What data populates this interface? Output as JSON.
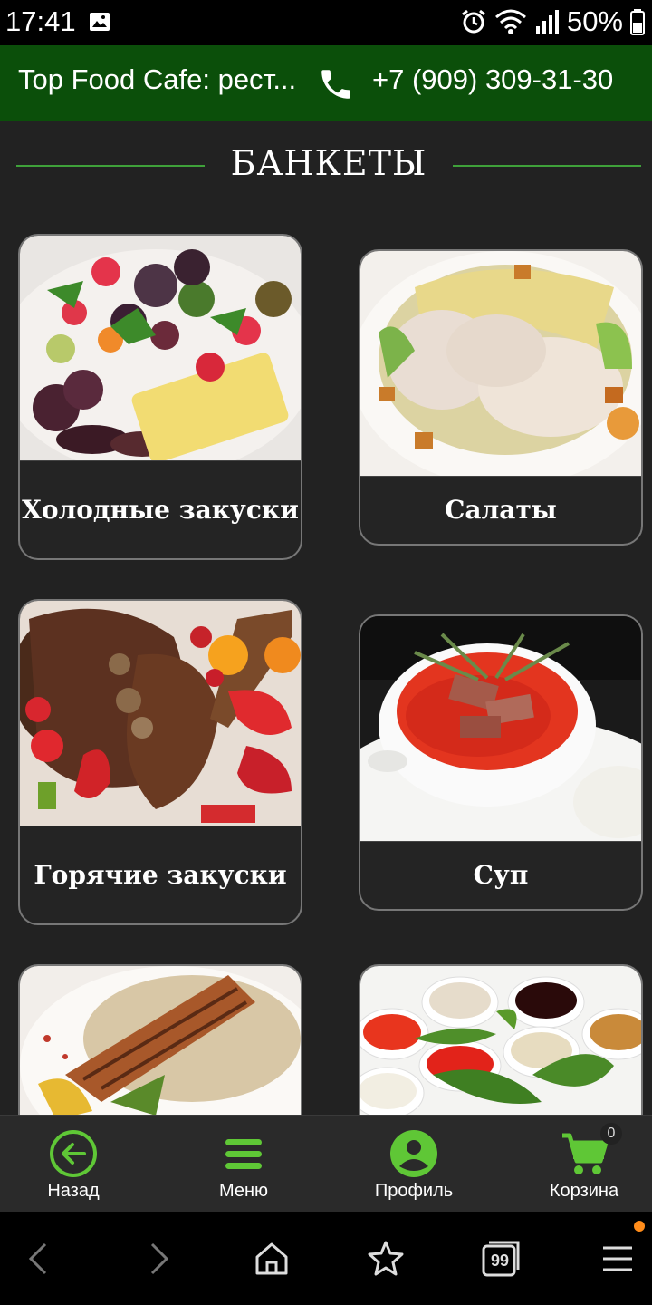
{
  "status_bar": {
    "time": "17:41",
    "battery": "50%",
    "icons": [
      "image-icon",
      "alarm-icon",
      "wifi-icon",
      "signal-icon"
    ]
  },
  "header": {
    "title": "Top Food Cafe: рест...",
    "phone": "+7 (909) 309-31-30",
    "background": "#0b4f0a"
  },
  "section": {
    "title": "БАНКЕТЫ",
    "line_color": "#3fa13a"
  },
  "cards": [
    {
      "label": "Холодные закуски",
      "image": "fruit-platter-photo"
    },
    {
      "label": "Салаты",
      "image": "chicken-salad-photo"
    },
    {
      "label": "Горячие закуски",
      "image": "roast-meat-photo"
    },
    {
      "label": "Суп",
      "image": "borscht-photo"
    },
    {
      "label": "",
      "image": "salmon-rice-photo"
    },
    {
      "label": "",
      "image": "sauces-photo"
    }
  ],
  "app_nav": {
    "items": [
      {
        "label": "Назад",
        "icon": "back-arrow-icon"
      },
      {
        "label": "Меню",
        "icon": "menu-icon"
      },
      {
        "label": "Профиль",
        "icon": "profile-icon"
      },
      {
        "label": "Корзина",
        "icon": "cart-icon"
      }
    ],
    "cart_count": "0",
    "accent": "#5fc736"
  },
  "browser_nav": {
    "tabs_count": "99",
    "icons": [
      "back-icon",
      "forward-icon",
      "home-icon",
      "favorites-icon",
      "tabs-icon",
      "menu-icon"
    ]
  }
}
